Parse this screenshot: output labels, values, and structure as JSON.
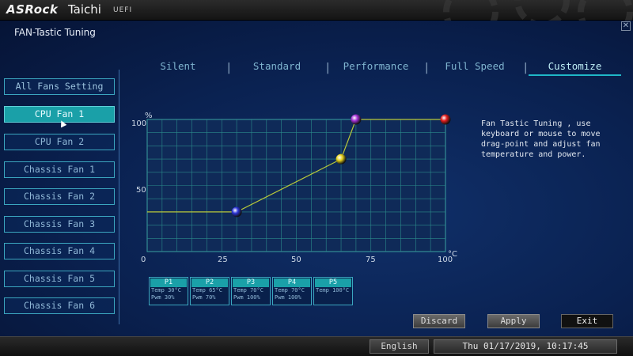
{
  "header": {
    "brand": "ASRock",
    "model": "Taichi",
    "uefi": "UEFI"
  },
  "page": {
    "title": "FAN-Tastic Tuning"
  },
  "tabs": [
    {
      "label": "Silent",
      "active": false
    },
    {
      "label": "Standard",
      "active": false
    },
    {
      "label": "Performance",
      "active": false
    },
    {
      "label": "Full Speed",
      "active": false
    },
    {
      "label": "Customize",
      "active": true
    }
  ],
  "sidebar": {
    "items": [
      {
        "label": "All Fans Setting"
      },
      {
        "label": "CPU Fan 1",
        "active": true
      },
      {
        "label": "CPU Fan 2"
      },
      {
        "label": "Chassis Fan 1"
      },
      {
        "label": "Chassis Fan 2"
      },
      {
        "label": "Chassis Fan 3"
      },
      {
        "label": "Chassis Fan 4"
      },
      {
        "label": "Chassis Fan 5"
      },
      {
        "label": "Chassis Fan 6"
      }
    ]
  },
  "chart": {
    "y_unit": "%",
    "x_unit": "°C",
    "x_ticks": [
      "0",
      "25",
      "50",
      "75",
      "100"
    ],
    "y_ticks": [
      "100",
      "50"
    ]
  },
  "chart_data": {
    "type": "line",
    "xlim": [
      0,
      100
    ],
    "ylim": [
      0,
      100
    ],
    "grid": true,
    "xlabel": "°C",
    "ylabel": "%",
    "series": [
      {
        "x": [
          0,
          30,
          65,
          70,
          100
        ],
        "y": [
          30,
          30,
          70,
          100,
          100
        ],
        "points": [
          {
            "id": "P1",
            "x": 30,
            "y": 30,
            "color": "#2a33d6"
          },
          {
            "id": "P2",
            "x": 65,
            "y": 70,
            "color": "#e6d21c"
          },
          {
            "id": "P3",
            "x": 70,
            "y": 100,
            "color": "#a12fd4"
          },
          {
            "id": "P4",
            "x": 70,
            "y": 100,
            "color": "#a12fd4"
          },
          {
            "id": "P5",
            "x": 100,
            "y": 100,
            "color": "#e31c1c"
          }
        ]
      }
    ]
  },
  "help": {
    "text": "Fan Tastic Tuning , use keyboard or mouse to move drag-point and adjust fan temperature and power."
  },
  "points": [
    {
      "label": "P1",
      "temp": "Temp 30°C",
      "pwm": "Pwm  30%"
    },
    {
      "label": "P2",
      "temp": "Temp 65°C",
      "pwm": "Pwm  70%"
    },
    {
      "label": "P3",
      "temp": "Temp 70°C",
      "pwm": "Pwm  100%"
    },
    {
      "label": "P4",
      "temp": "Temp 70°C",
      "pwm": "Pwm  100%"
    },
    {
      "label": "P5",
      "temp": "Temp 100°C",
      "pwm": ""
    }
  ],
  "actions": {
    "discard": "Discard",
    "apply": "Apply",
    "exit": "Exit"
  },
  "footer": {
    "language": "English",
    "datetime": "Thu 01/17/2019, 10:17:45"
  },
  "colors": {
    "accent": "#1aa0a8",
    "background": "#0a2150",
    "curve": "#b8c83a",
    "grid": "#2b8a8a"
  }
}
